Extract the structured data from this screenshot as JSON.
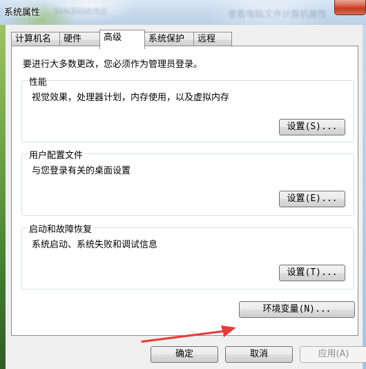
{
  "window": {
    "title": "系统属性",
    "background_text_left": "SVN源码修改后",
    "background_text_right": "查看电脑文件计算机属性"
  },
  "tabs": [
    {
      "label": "计算机名",
      "active": false
    },
    {
      "label": "硬件",
      "active": false
    },
    {
      "label": "高级",
      "active": true
    },
    {
      "label": "系统保护",
      "active": false
    },
    {
      "label": "远程",
      "active": false
    }
  ],
  "admin_note": "要进行大多数更改，您必须作为管理员登录。",
  "performance": {
    "title": "性能",
    "description": "视觉效果，处理器计划，内存使用，以及虚拟内存",
    "button": "设置(S)..."
  },
  "user_profiles": {
    "title": "用户配置文件",
    "description": "与您登录有关的桌面设置",
    "button": "设置(E)..."
  },
  "startup_recovery": {
    "title": "启动和故障恢复",
    "description": "系统启动、系统失败和调试信息",
    "button": "设置(T)..."
  },
  "env_button": "环境变量(N)...",
  "footer": {
    "ok": "确定",
    "cancel": "取消",
    "apply": "应用(A)"
  },
  "colors": {
    "annotation_arrow": "#e83a3a",
    "tab_border": "#898c95",
    "group_border": "#d5dfe5"
  }
}
